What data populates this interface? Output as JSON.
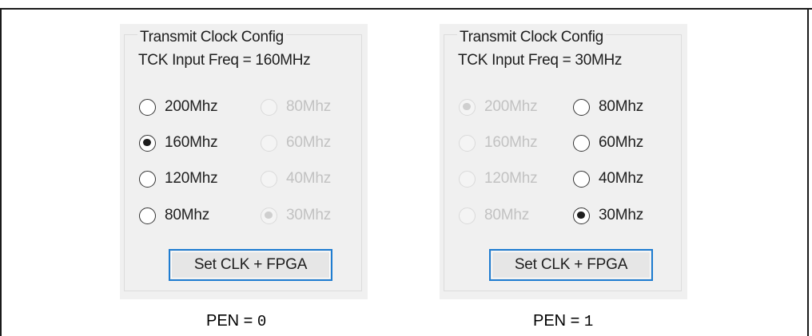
{
  "panels": [
    {
      "group_title": "Transmit Clock Config",
      "freq_label": "TCK Input Freq = 160MHz",
      "left_options": [
        {
          "label": "200Mhz",
          "selected": false,
          "enabled": true
        },
        {
          "label": "160Mhz",
          "selected": true,
          "enabled": true
        },
        {
          "label": "120Mhz",
          "selected": false,
          "enabled": true
        },
        {
          "label": "80Mhz",
          "selected": false,
          "enabled": true
        }
      ],
      "right_options": [
        {
          "label": "80Mhz",
          "selected": false,
          "enabled": false
        },
        {
          "label": "60Mhz",
          "selected": false,
          "enabled": false
        },
        {
          "label": "40Mhz",
          "selected": false,
          "enabled": false
        },
        {
          "label": "30Mhz",
          "selected": true,
          "enabled": false
        }
      ],
      "button_label": "Set CLK + FPGA",
      "caption_prefix": "PEN = ",
      "caption_value": "0"
    },
    {
      "group_title": "Transmit Clock Config",
      "freq_label": "TCK Input Freq = 30MHz",
      "left_options": [
        {
          "label": "200Mhz",
          "selected": true,
          "enabled": false
        },
        {
          "label": "160Mhz",
          "selected": false,
          "enabled": false
        },
        {
          "label": "120Mhz",
          "selected": false,
          "enabled": false
        },
        {
          "label": "80Mhz",
          "selected": false,
          "enabled": false
        }
      ],
      "right_options": [
        {
          "label": "80Mhz",
          "selected": false,
          "enabled": true
        },
        {
          "label": "60Mhz",
          "selected": false,
          "enabled": true
        },
        {
          "label": "40Mhz",
          "selected": false,
          "enabled": true
        },
        {
          "label": "30Mhz",
          "selected": true,
          "enabled": true
        }
      ],
      "button_label": "Set CLK + FPGA",
      "caption_prefix": "PEN = ",
      "caption_value": "1"
    }
  ]
}
